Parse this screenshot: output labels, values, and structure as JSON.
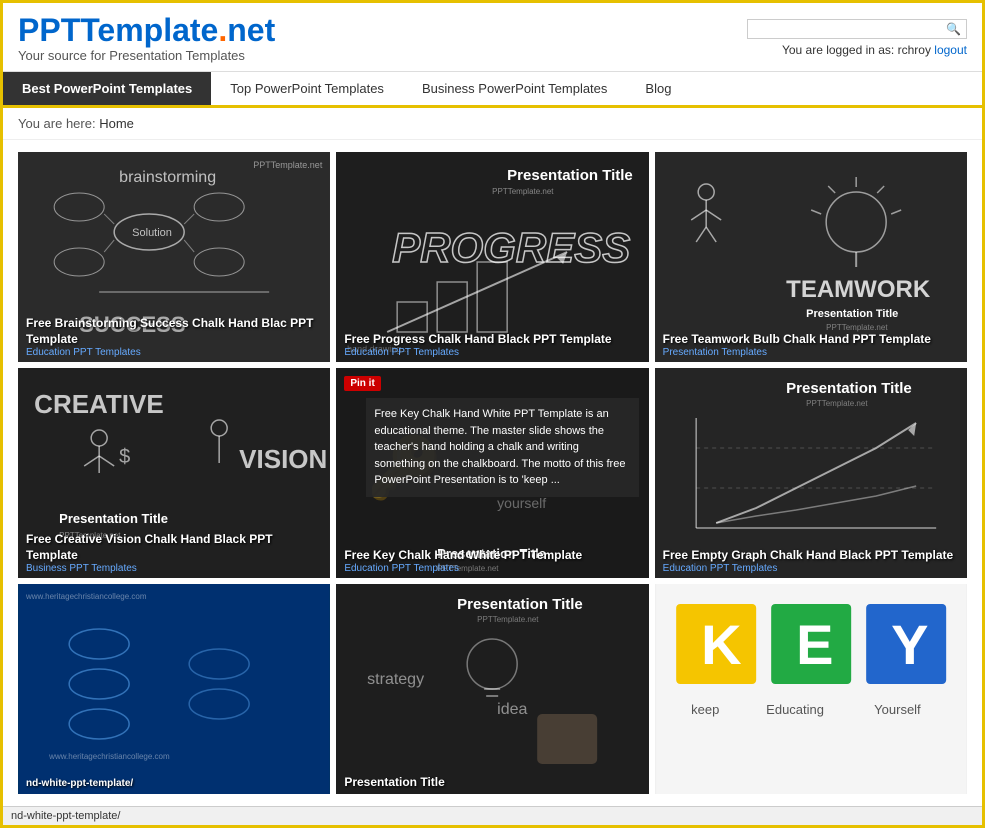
{
  "header": {
    "logo_ppt": "PPT",
    "logo_template": "Template",
    "logo_dot": ".",
    "logo_net": "net",
    "subtitle": "Your source for Presentation Templates",
    "search_placeholder": "",
    "login_text": "You are logged in as: rchroy",
    "logout_label": "logout"
  },
  "nav": {
    "items": [
      {
        "label": "Best PowerPoint Templates",
        "active": true
      },
      {
        "label": "Top PowerPoint Templates",
        "active": false
      },
      {
        "label": "Business PowerPoint Templates",
        "active": false
      },
      {
        "label": "Blog",
        "active": false
      }
    ]
  },
  "breadcrumb": {
    "prefix": "You are here:",
    "home": "Home"
  },
  "cards": [
    {
      "id": 1,
      "title": "Free Brainstorming Success Chalk Hand Blac PPT Template",
      "category": "Education PPT Templates",
      "watermark": "PPTTemplate.net",
      "bg": "#2d2d2d",
      "words": [
        "brainstorming",
        "Solution",
        "SUCCESS"
      ],
      "presentation_title": ""
    },
    {
      "id": 2,
      "title": "Free Progress Chalk Hand Black PPT Template",
      "category": "Education PPT Templates",
      "watermark": "PPTTemplate.net",
      "bg": "#1e1e1e",
      "words": [
        "PROGRESS"
      ],
      "presentation_title": "Presentation Title"
    },
    {
      "id": 3,
      "title": "Free Teamwork Bulb Chalk Hand PPT Template",
      "category": "Presentation Templates",
      "watermark": "PPTTemplate.net",
      "bg": "#2a2a2a",
      "words": [
        "TEAMWORK"
      ],
      "presentation_title": "Presentation Title"
    },
    {
      "id": 4,
      "title": "Free Creative Vision Chalk Hand Black PPT Template",
      "category": "Business PPT Templates",
      "watermark": "PPTTemplate.net",
      "bg": "#222222",
      "words": [
        "CREATIVE",
        "VISION"
      ],
      "presentation_title": "Presentation Title"
    },
    {
      "id": 5,
      "title": "Free Key Chalk Hand White PPT Template",
      "category": "Education PPT Templates",
      "watermark": "",
      "bg": "#1a1a1a",
      "tooltip": "Free Key Chalk Hand White PPT Template is an educational theme. The master slide shows the teacher's hand holding a chalk and writing something on the chalkboard. The motto of this free PowerPoint Presentation is to 'keep ...",
      "presentation_title": "Presentation Title"
    },
    {
      "id": 6,
      "title": "Free Empty Graph Chalk Hand Black PPT Template",
      "category": "Education PPT Templates",
      "watermark": "PPTTemplate.net",
      "bg": "#252525",
      "words": [],
      "presentation_title": "Presentation Title"
    },
    {
      "id": 7,
      "title": "nd-white-ppt-template/",
      "category": "",
      "watermark": "www.heritagechristiancollege.com",
      "bg": "#003366",
      "words": [],
      "presentation_title": ""
    },
    {
      "id": 8,
      "title": "",
      "category": "",
      "watermark": "PPTTemplate.net",
      "bg": "#1e1e1e",
      "words": [
        "strategy",
        "idea"
      ],
      "presentation_title": "Presentation Title"
    },
    {
      "id": 9,
      "title": "",
      "category": "",
      "watermark": "",
      "bg": "#f5f5f5",
      "words": [
        "K",
        "E",
        "Y",
        "keep",
        "Educating",
        "Yourself"
      ],
      "presentation_title": ""
    }
  ],
  "status_bar": {
    "url": "nd-white-ppt-template/"
  },
  "icons": {
    "search": "🔍"
  }
}
